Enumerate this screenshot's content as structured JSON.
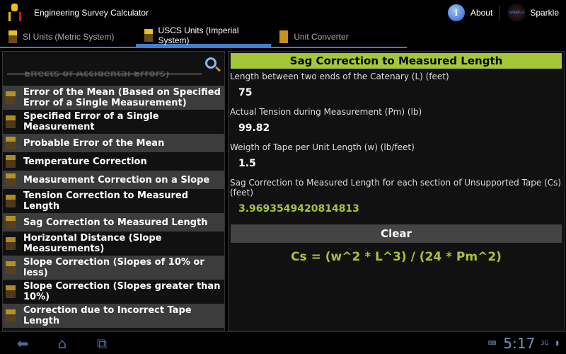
{
  "app": {
    "title": "Engineering Survey Calculator",
    "about": "About",
    "sparkle": "Sparkle",
    "sparkle_logo": "SPARKLE"
  },
  "tabs": [
    {
      "label": "SI Units (Metric System)"
    },
    {
      "label": "USCS Units (Imperial System)",
      "selected": true
    },
    {
      "label": "Unit Converter"
    }
  ],
  "list": {
    "search_placeholder": "",
    "cut_item": "Effects of Accidental Errors)",
    "items": [
      {
        "label": "Error of the Mean (Based on Specified Error of a Single Measurement)"
      },
      {
        "label": "Specified Error of a Single Measurement"
      },
      {
        "label": "Probable Error of the Mean"
      },
      {
        "label": "Temperature Correction"
      },
      {
        "label": "Measurement Correction on a Slope"
      },
      {
        "label": "Tension Correction to Measured Length"
      },
      {
        "label": "Sag Correction to Measured Length"
      },
      {
        "label": "Horizontal Distance (Slope Measurements)"
      },
      {
        "label": "Slope Correction (Slopes of 10% or less)"
      },
      {
        "label": "Slope Correction (Slopes greater than 10%)"
      },
      {
        "label": "Correction due to Incorrect Tape Length"
      }
    ]
  },
  "form": {
    "title": "Sag Correction to Measured Length",
    "fields": [
      {
        "label": "Length between two ends of the Catenary (L) (feet)",
        "value": "75"
      },
      {
        "label": "Actual Tension during Measurement (Pm) (lb)",
        "value": "99.82"
      },
      {
        "label": "Weigth of Tape per Unit Length (w) (lb/feet)",
        "value": "1.5"
      }
    ],
    "result_label": "Sag Correction to Measured Length for each section of Unsupported Tape (Cs) (feet)",
    "result": "3.9693549420814813",
    "clear": "Clear",
    "formula": "Cs = (w^2 * L^3) / (24 * Pm^2)"
  },
  "status": {
    "time": "5:17",
    "network": "3G"
  },
  "colors": {
    "accent": "#a4c639",
    "tab": "#3f7fd0"
  }
}
